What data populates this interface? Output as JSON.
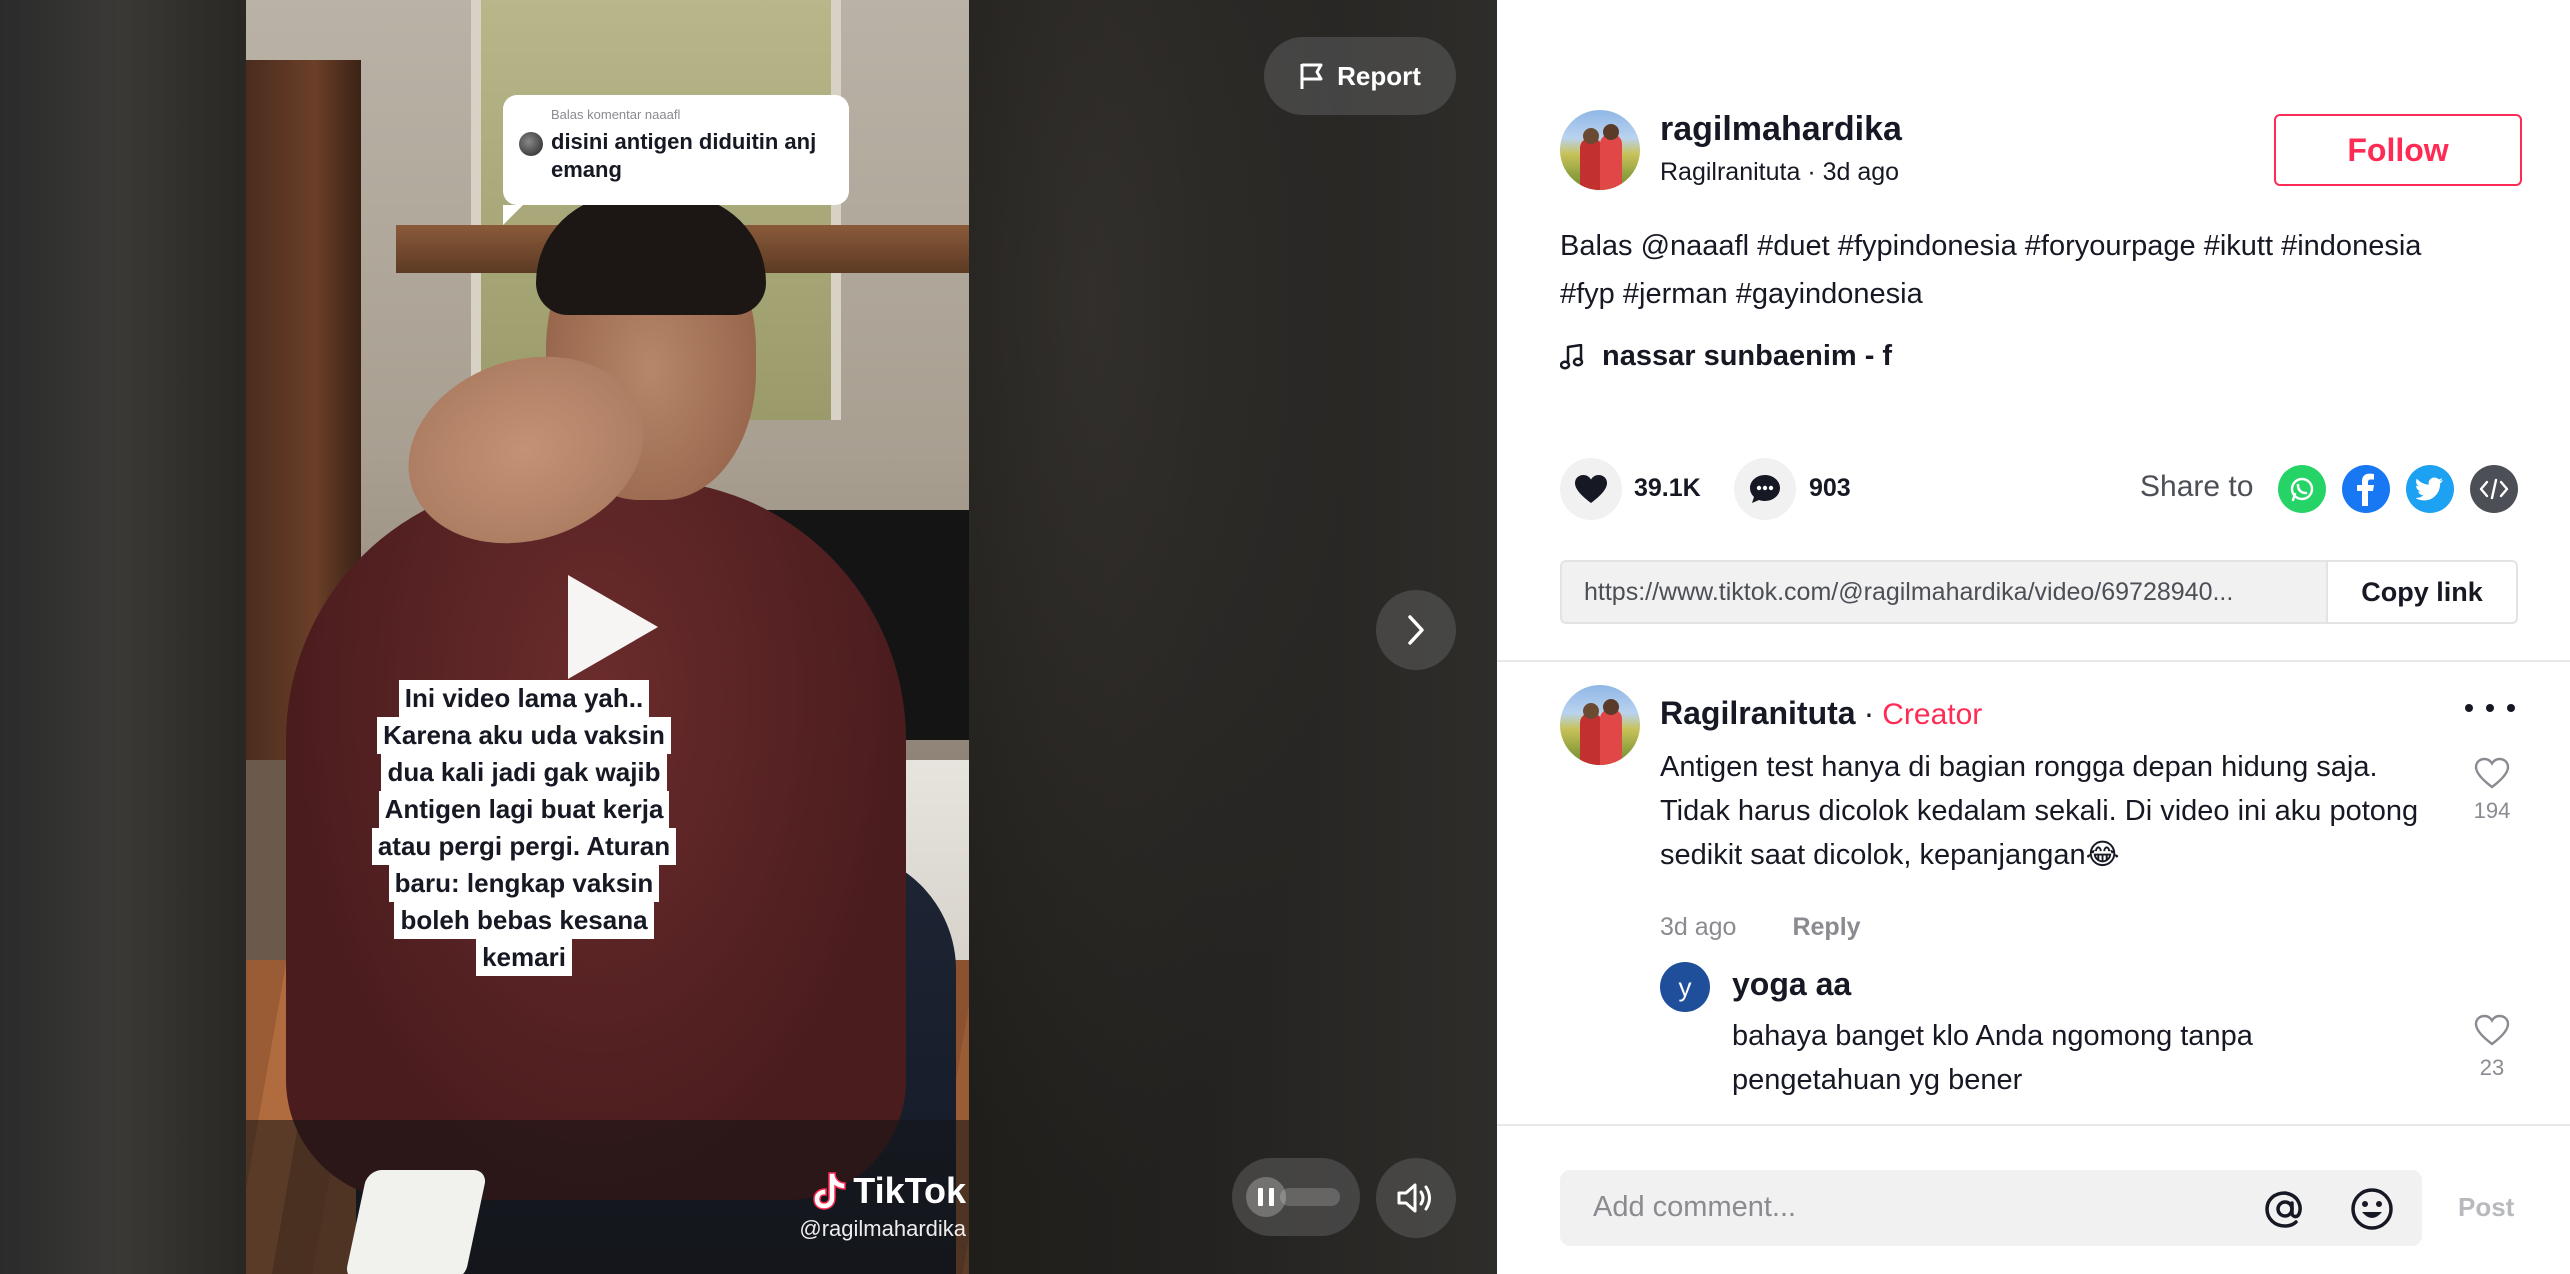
{
  "video": {
    "reply_label": "Balas komentar naaafl",
    "reply_text": "disini antigen diduitin anj emang",
    "caption_lines": [
      "Ini video lama yah..",
      "Karena aku uda vaksin",
      "dua kali jadi gak wajib",
      "Antigen lagi buat kerja",
      "atau pergi pergi. Aturan",
      "baru:  lengkap vaksin",
      "boleh bebas kesana",
      "kemari"
    ],
    "watermark_brand": "TikTok",
    "watermark_handle": "@ragilmahardika",
    "report_label": "Report",
    "icons": {
      "report": "flag-icon",
      "play": "play-icon",
      "next": "chevron-right-icon",
      "pause": "pause-icon",
      "volume": "volume-icon"
    }
  },
  "author": {
    "username": "ragilmahardika",
    "nickname": "Ragilranituta",
    "time": "3d ago",
    "follow_label": "Follow"
  },
  "post": {
    "description_prefix": "Balas ",
    "mention": "@naaafl",
    "hashtags_line1": "#duet #fypindonesia #foryourpage #ikutt #indonesia",
    "hashtags_line2": "#fyp #jerman #gayindonesia",
    "music": "nassar sunbaenim - f"
  },
  "stats": {
    "likes": "39.1K",
    "comments": "903",
    "share_label": "Share to",
    "share_targets": [
      "whatsapp-icon",
      "facebook-icon",
      "twitter-icon",
      "embed-icon"
    ]
  },
  "link": {
    "url": "https://www.tiktok.com/@ragilmahardika/video/69728940...",
    "copy_label": "Copy link"
  },
  "comments": [
    {
      "author": "Ragilranituta",
      "badge": "Creator",
      "text": "Antigen test hanya di bagian rongga depan hidung saja. Tidak harus dicolok kedalam sekali. Di video ini aku potong sedikit saat dicolok, kepanjangan😂",
      "time": "3d ago",
      "reply_label": "Reply",
      "likes": "194",
      "replies": [
        {
          "avatar_letter": "y",
          "author": "yoga aa",
          "text": "bahaya banget klo Anda ngomong tanpa pengetahuan yg bener",
          "likes": "23"
        }
      ]
    }
  ],
  "composer": {
    "placeholder": "Add comment...",
    "post_label": "Post"
  },
  "colors": {
    "brand": "#fe2c55",
    "whatsapp": "#25d366",
    "facebook": "#1877f2",
    "twitter": "#1da1f2",
    "embed": "#4d4f57"
  }
}
